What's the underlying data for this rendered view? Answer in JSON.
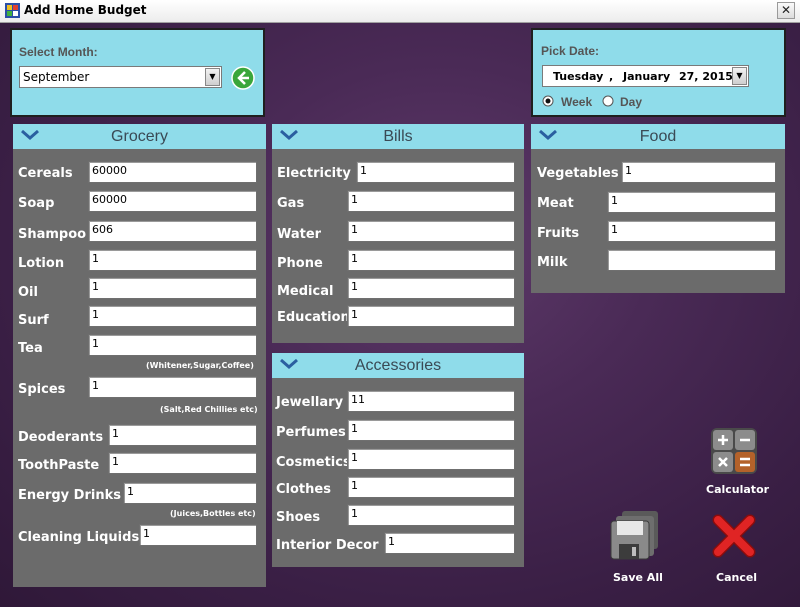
{
  "window": {
    "title": "Add Home Budget",
    "close_glyph": "✕"
  },
  "month": {
    "label": "Select Month:",
    "value": "September"
  },
  "date": {
    "label": "Pick Date:",
    "weekday": "Tuesday",
    "comma": ",",
    "month": "January",
    "daysyear": "27, 2015",
    "radio_week": "Week",
    "radio_day": "Day",
    "selected_radio": "Week"
  },
  "grocery": {
    "title": "Grocery",
    "fields": [
      {
        "label": "Cereals",
        "value": "60000"
      },
      {
        "label": "Soap",
        "value": "60000"
      },
      {
        "label": "Shampoo",
        "value": "606"
      },
      {
        "label": "Lotion",
        "value": "1"
      },
      {
        "label": "Oil",
        "value": "1"
      },
      {
        "label": "Surf",
        "value": "1"
      },
      {
        "label": "Tea",
        "value": "1",
        "hint": "(Whitener,Sugar,Coffee)"
      },
      {
        "label": "Spices",
        "value": "1",
        "hint": "(Salt,Red Chillies etc)"
      },
      {
        "label": "Deoderants",
        "value": "1"
      },
      {
        "label": "ToothPaste",
        "value": "1"
      },
      {
        "label": "Energy Drinks",
        "value": "1",
        "hint": "(Juices,Bottles etc)"
      },
      {
        "label": "Cleaning Liquids",
        "value": "1"
      }
    ]
  },
  "bills": {
    "title": "Bills",
    "fields": [
      {
        "label": "Electricity",
        "value": "1"
      },
      {
        "label": "Gas",
        "value": "1"
      },
      {
        "label": "Water",
        "value": "1"
      },
      {
        "label": "Phone",
        "value": "1"
      },
      {
        "label": "Medical",
        "value": "1"
      },
      {
        "label": "Education",
        "value": "1"
      }
    ]
  },
  "food": {
    "title": "Food",
    "fields": [
      {
        "label": "Vegetables",
        "value": "1"
      },
      {
        "label": "Meat",
        "value": "1"
      },
      {
        "label": "Fruits",
        "value": "1"
      },
      {
        "label": "Milk",
        "value": ""
      }
    ]
  },
  "accessories": {
    "title": "Accessories",
    "fields": [
      {
        "label": "Jewellary",
        "value": "11"
      },
      {
        "label": "Perfumes",
        "value": "1"
      },
      {
        "label": "Cosmetics",
        "value": "1"
      },
      {
        "label": "Clothes",
        "value": "1"
      },
      {
        "label": "Shoes",
        "value": "1"
      },
      {
        "label": "Interior Decor",
        "value": "1"
      }
    ]
  },
  "actions": {
    "calculator_label": "Calculator",
    "save_label": "Save All",
    "cancel_label": "Cancel"
  },
  "icons": {
    "app": "app-icon",
    "back": "back-arrow-icon",
    "chevron": "chevron-down-icon",
    "calculator": "calculator-icon",
    "save": "floppy-disk-icon",
    "cancel": "red-x-icon"
  },
  "colors": {
    "panel_header": "#8fdcea",
    "panel_body": "#6b6b6b",
    "accent_green": "#3aa63a",
    "cancel_red": "#d42020"
  }
}
